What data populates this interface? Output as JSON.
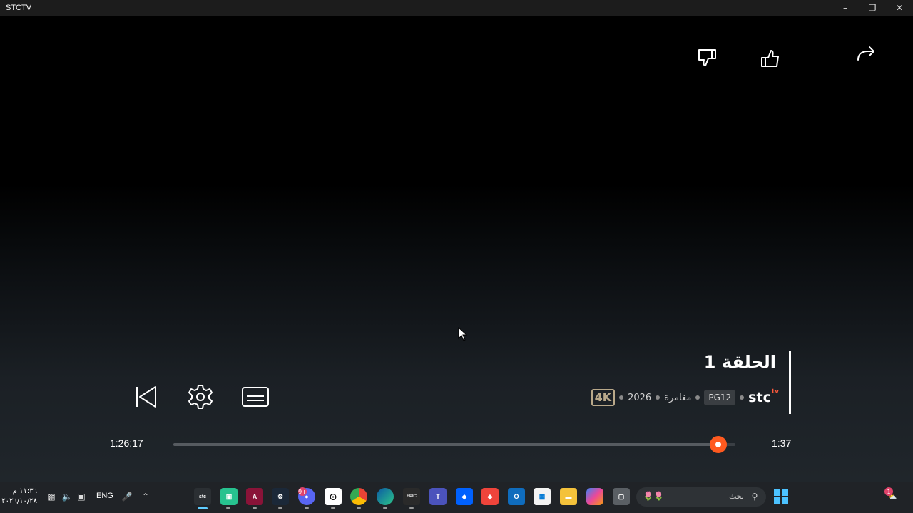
{
  "window": {
    "title": "STCTV",
    "minimize_icon": "minimize-icon",
    "restore_icon": "restore-icon",
    "close_icon": "close-icon"
  },
  "player": {
    "episode_title": "الحلقة 1",
    "meta": {
      "brand_logo": "stc",
      "brand_logo_sup": "tv",
      "rating": "PG12",
      "genre": "مغامرة",
      "year": "2026",
      "quality": "4K"
    },
    "elapsed_time": "1:26:17",
    "remaining_time": "1:37",
    "progress": 0.97,
    "top_actions": [
      "dislike-icon",
      "like-icon",
      "share-icon"
    ],
    "controls": [
      "previous-episode-icon",
      "settings-icon",
      "subtitles-icon"
    ],
    "accent_color": "#ff5a1f"
  },
  "taskbar": {
    "clock_time": "١١:٣٦ م",
    "clock_date": "٢٠٢٦/١٠/٢٨",
    "language": "ENG",
    "search_placeholder": "بحث",
    "notification_badge": "1",
    "discord_badge": "9+",
    "apps": [
      "stctv",
      "app",
      "affinity",
      "steam",
      "discord",
      "capcut",
      "chrome",
      "edge",
      "epic-games",
      "teams",
      "dropbox",
      "anydesk",
      "outlook",
      "microsoft-store",
      "file-explorer",
      "copilot",
      "windows-sandbox"
    ]
  }
}
